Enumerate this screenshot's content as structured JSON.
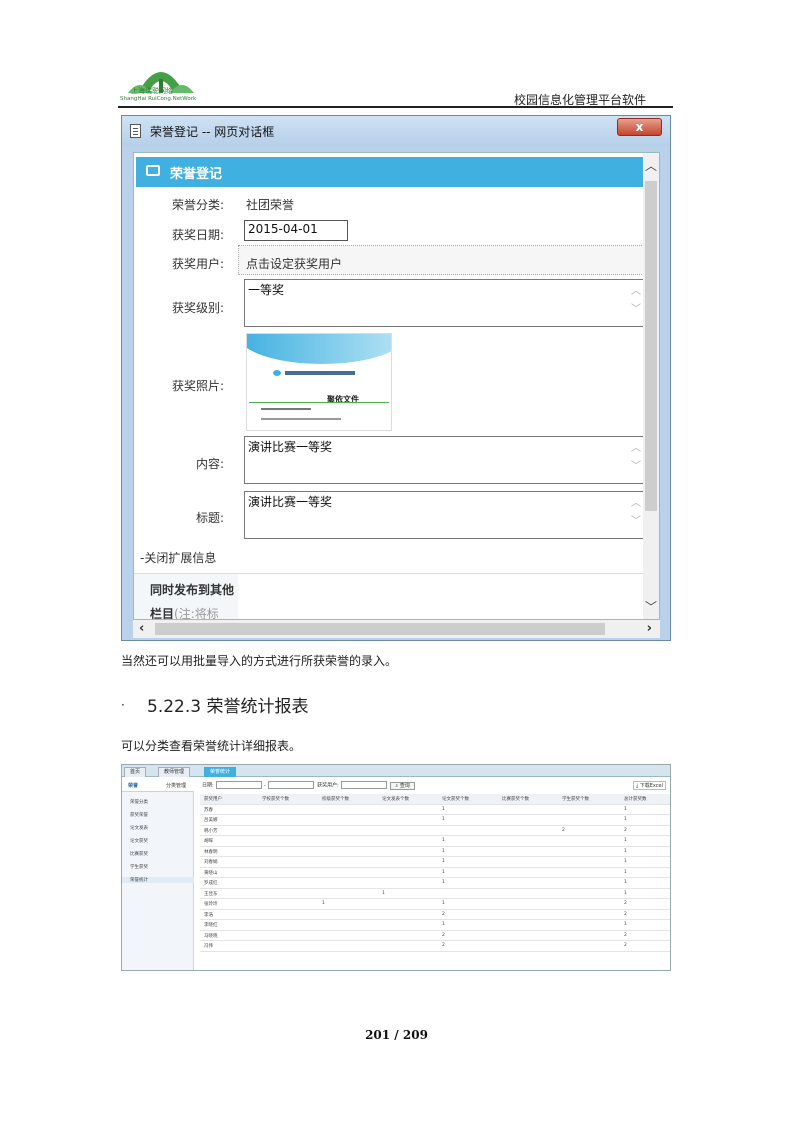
{
  "header": {
    "company_cn": "上海瑞聪网络",
    "company_en": "ShangHai RuiCong.NetWork",
    "title": "校园信息化管理平台软件"
  },
  "dialog": {
    "window_title": "荣誉登记 -- 网页对话框",
    "close_label": "x",
    "form_title": "荣誉登记",
    "fields": {
      "category_label": "荣誉分类:",
      "category_value": "社团荣誉",
      "date_label": "获奖日期:",
      "date_value": "2015-04-01",
      "user_label": "获奖用户:",
      "user_value": "点击设定获奖用户",
      "level_label": "获奖级别:",
      "level_value": "一等奖",
      "photo_label": "获奖照片:",
      "content_label": "内容:",
      "content_value": "演讲比赛一等奖",
      "title_label": "标题:",
      "title_value": "演讲比赛一等奖"
    },
    "photo": {
      "doc_title": "聚依文件"
    },
    "extension": {
      "toggle_label": "-关闭扩展信息",
      "publish_label_line1": "同时发布到其他",
      "publish_label_line2_bold": "栏目",
      "publish_label_line2_note": "(注:将标"
    }
  },
  "text": {
    "para1": "当然还可以用批量导入的方式进行所获荣誉的录入。",
    "bullet": "·",
    "section_title": "5.22.3 荣誉统计报表",
    "para2": "可以分类查看荣誉统计详细报表。"
  },
  "report": {
    "tabs": [
      "首页",
      "教师管理",
      "荣誉统计"
    ],
    "side_head": [
      "荣誉",
      "分类管理"
    ],
    "side_items": [
      "荣誉分类",
      "获奖荣誉",
      "论文发表",
      "论文获奖",
      "比赛获奖",
      "学生获奖",
      "荣誉统计"
    ],
    "toolbar": {
      "date_label": "日期:",
      "dash": "-",
      "user_label": "获奖用户:",
      "search": "查询",
      "export": "下载Excel"
    },
    "columns": [
      "获奖用户",
      "学校获奖个数",
      "校级获奖个数",
      "论文发表个数",
      "论文获奖个数",
      "比赛获奖个数",
      "学生获奖个数",
      "总计获奖数"
    ],
    "rows": [
      [
        "苏春",
        "",
        "",
        "",
        "1",
        "",
        "",
        "1"
      ],
      [
        "吕美娜",
        "",
        "",
        "",
        "1",
        "",
        "",
        "1"
      ],
      [
        "韩小芳",
        "",
        "",
        "",
        "",
        "",
        "2",
        "2"
      ],
      [
        "胡晖",
        "",
        "",
        "",
        "1",
        "",
        "",
        "1"
      ],
      [
        "林春明",
        "",
        "",
        "",
        "1",
        "",
        "",
        "1"
      ],
      [
        "刘春娟",
        "",
        "",
        "",
        "1",
        "",
        "",
        "1"
      ],
      [
        "黄晓山",
        "",
        "",
        "",
        "1",
        "",
        "",
        "1"
      ],
      [
        "罗成红",
        "",
        "",
        "",
        "1",
        "",
        "",
        "1"
      ],
      [
        "王佳东",
        "",
        "",
        "1",
        "",
        "",
        "",
        "1"
      ],
      [
        "张玲玲",
        "",
        "1",
        "",
        "1",
        "",
        "",
        "2"
      ],
      [
        "李浩",
        "",
        "",
        "",
        "2",
        "",
        "",
        "2"
      ],
      [
        "李晓红",
        "",
        "",
        "",
        "1",
        "",
        "",
        "1"
      ],
      [
        "马晓晓",
        "",
        "",
        "",
        "2",
        "",
        "",
        "2"
      ],
      [
        "冯伟",
        "",
        "",
        "",
        "2",
        "",
        "",
        "2"
      ]
    ]
  },
  "footer": {
    "page": "201 / 209"
  },
  "colors": {
    "accent": "#3fb0e0",
    "logo_green": "#2e7d32"
  }
}
